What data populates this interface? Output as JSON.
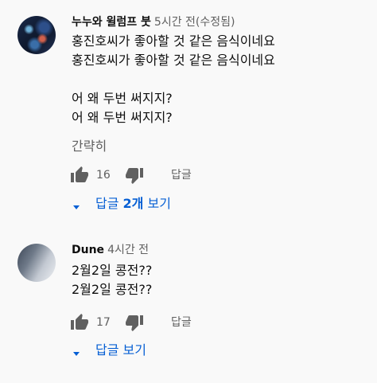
{
  "comments": [
    {
      "author": "누누와 윌럼프 붓",
      "time": "5시간 전(수정됨)",
      "lines": [
        "홍진호씨가 좋아할 것 같은 음식이네요",
        "홍진호씨가 좋아할 것 같은 음식이네요",
        "",
        "어 왜 두번 써지지?",
        "어 왜 두번 써지지?"
      ],
      "less_label": "간략히",
      "likes": "16",
      "reply_label": "답글",
      "replies_prefix": "답글 ",
      "replies_count": "2개",
      "replies_suffix": " 보기"
    },
    {
      "author": "Dune",
      "time": "4시간 전",
      "lines": [
        "2월2일 콩전??",
        "2월2일 콩전??"
      ],
      "likes": "17",
      "reply_label": "답글",
      "replies_label": "답글 보기"
    }
  ],
  "colors": {
    "background": "#f9f9f9",
    "text": "#0f0f0f",
    "secondary": "#606060",
    "link": "#065fd4"
  },
  "icons": {
    "like": "thumbs-up-icon",
    "dislike": "thumbs-down-icon",
    "expand": "caret-down-icon"
  }
}
